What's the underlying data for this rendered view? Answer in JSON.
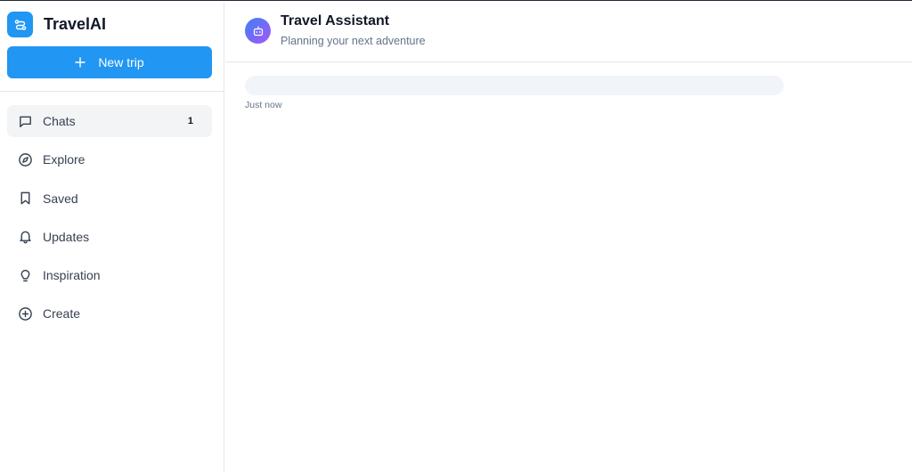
{
  "app": {
    "name": "TravelAI",
    "logo_icon": "route-icon",
    "accent_color": "#2196f3"
  },
  "sidebar": {
    "new_trip_label": "New trip",
    "items": [
      {
        "label": "Chats",
        "icon": "chat-icon",
        "count": "1",
        "active": true
      },
      {
        "label": "Explore",
        "icon": "compass-icon"
      },
      {
        "label": "Saved",
        "icon": "bookmark-icon"
      },
      {
        "label": "Updates",
        "icon": "bell-icon"
      },
      {
        "label": "Inspiration",
        "icon": "lightbulb-icon"
      },
      {
        "label": "Create",
        "icon": "plus-circle-icon"
      }
    ]
  },
  "chat": {
    "title": "Travel Assistant",
    "subtitle": "Planning your next adventure",
    "avatar_icon": "bot-icon",
    "messages": [
      {
        "text": "",
        "time": "Just now"
      }
    ]
  }
}
